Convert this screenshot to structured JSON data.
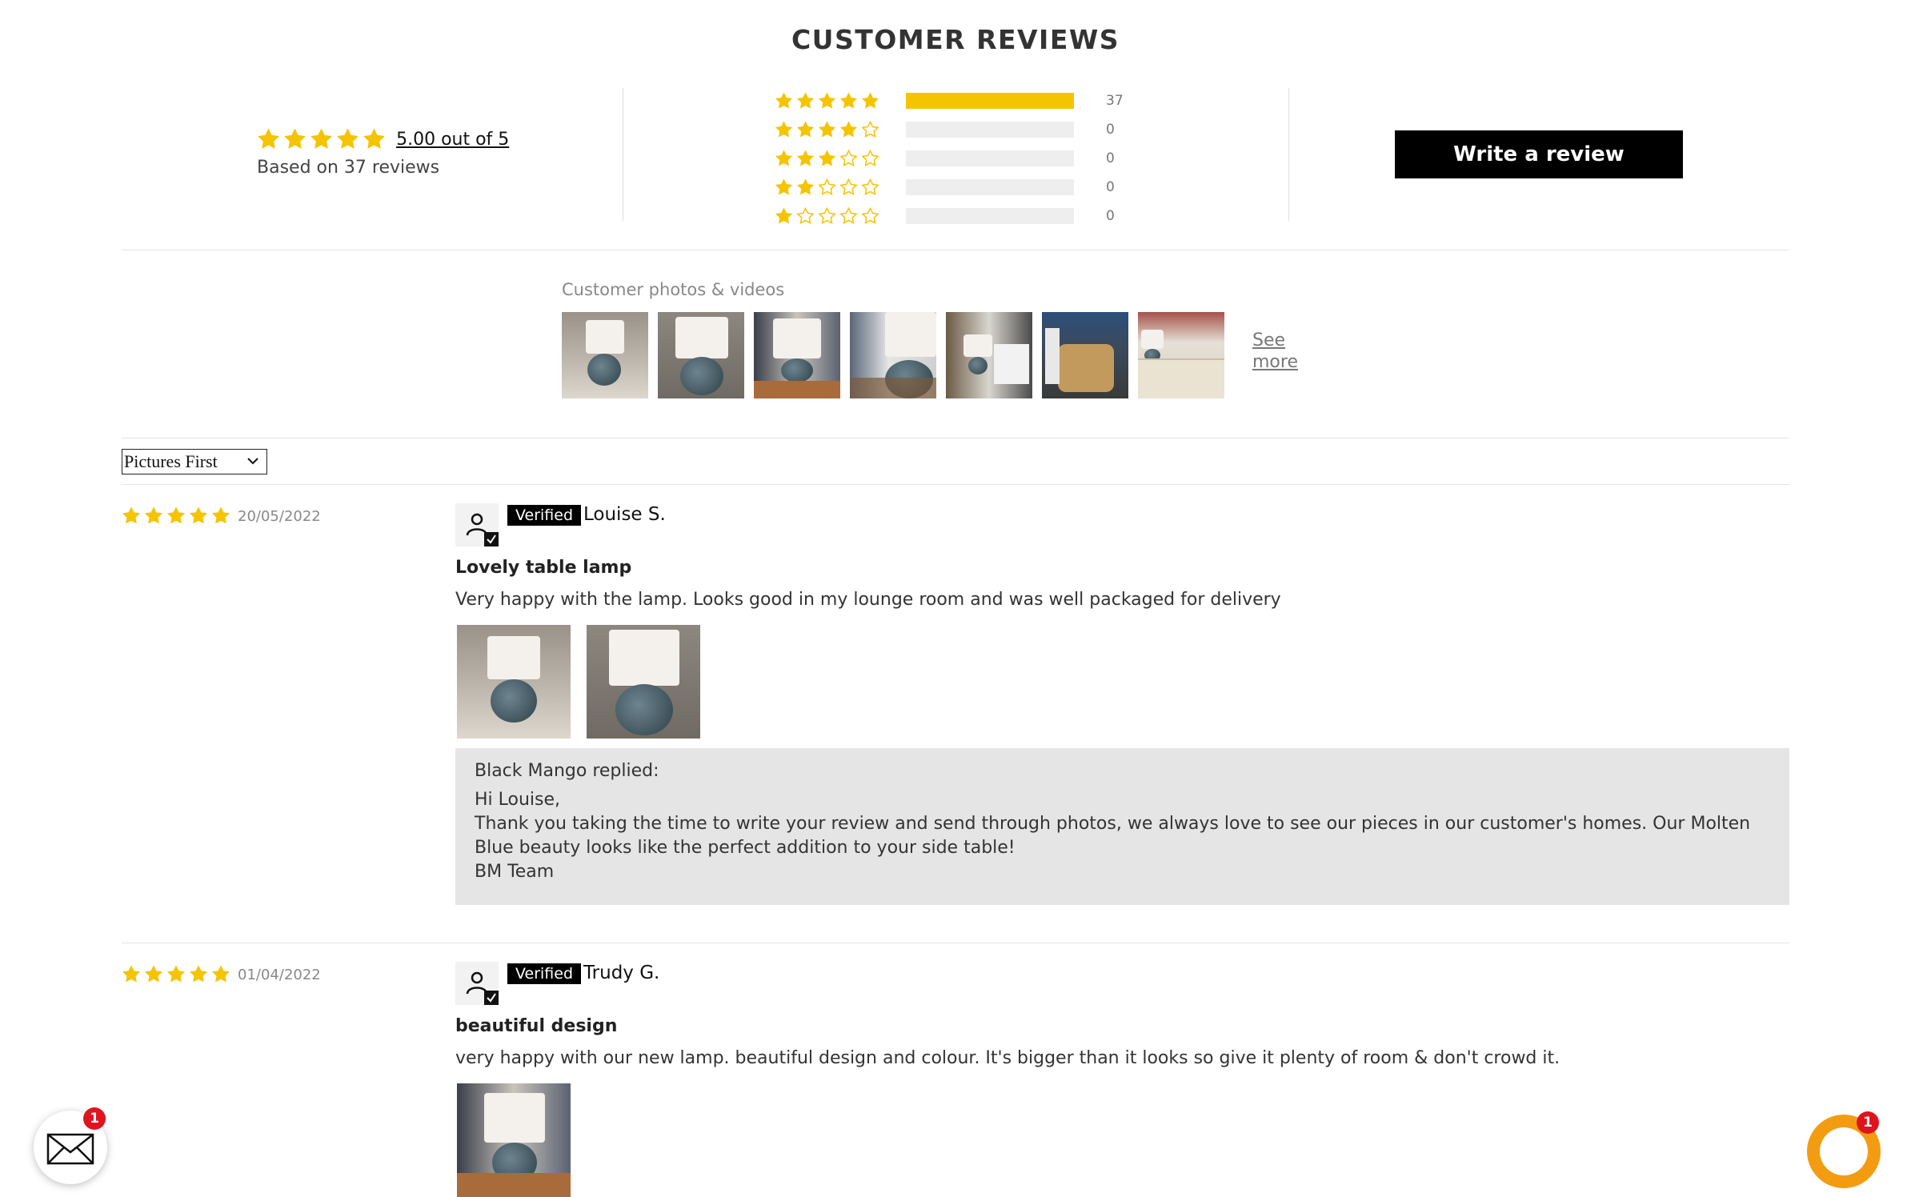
{
  "title": "CUSTOMER REVIEWS",
  "summary": {
    "average_text": "5.00 out of 5",
    "average_rating": 5,
    "based_on": "Based on 37 reviews"
  },
  "histogram": [
    {
      "stars": 5,
      "count": "37",
      "fraction": 1.0
    },
    {
      "stars": 4,
      "count": "0",
      "fraction": 0
    },
    {
      "stars": 3,
      "count": "0",
      "fraction": 0
    },
    {
      "stars": 2,
      "count": "0",
      "fraction": 0
    },
    {
      "stars": 1,
      "count": "0",
      "fraction": 0
    }
  ],
  "write_review_label": "Write a review",
  "photos": {
    "label": "Customer photos & videos",
    "see_more": "See more"
  },
  "sort": {
    "selected": "Pictures First"
  },
  "reviews": [
    {
      "rating": 5,
      "date": "20/05/2022",
      "verified": "Verified",
      "name": "Louise S.",
      "title": "Lovely table lamp",
      "body": "Very happy with the lamp. Looks good in my lounge room and was well packaged for delivery",
      "reply": {
        "who": "Black Mango replied:",
        "lines": [
          "Hi Louise,",
          "Thank you taking the time to write your review and send through photos, we always love to see our pieces in our customer's homes. Our Molten Blue beauty looks like the perfect addition to your side table!",
          "BM Team"
        ]
      }
    },
    {
      "rating": 5,
      "date": "01/04/2022",
      "verified": "Verified",
      "name": "Trudy G.",
      "title": "beautiful design",
      "body": "very happy with our new lamp. beautiful design and colour. It's bigger than it looks so give it plenty of room & don't crowd it."
    }
  ],
  "widgets": {
    "mail_badge": "1",
    "chat_badge": "1"
  },
  "colors": {
    "star": "#f5c400",
    "button": "#000000",
    "reply_bg": "#e5e5e5",
    "badge": "#e0141e",
    "chat": "#f39c12"
  }
}
